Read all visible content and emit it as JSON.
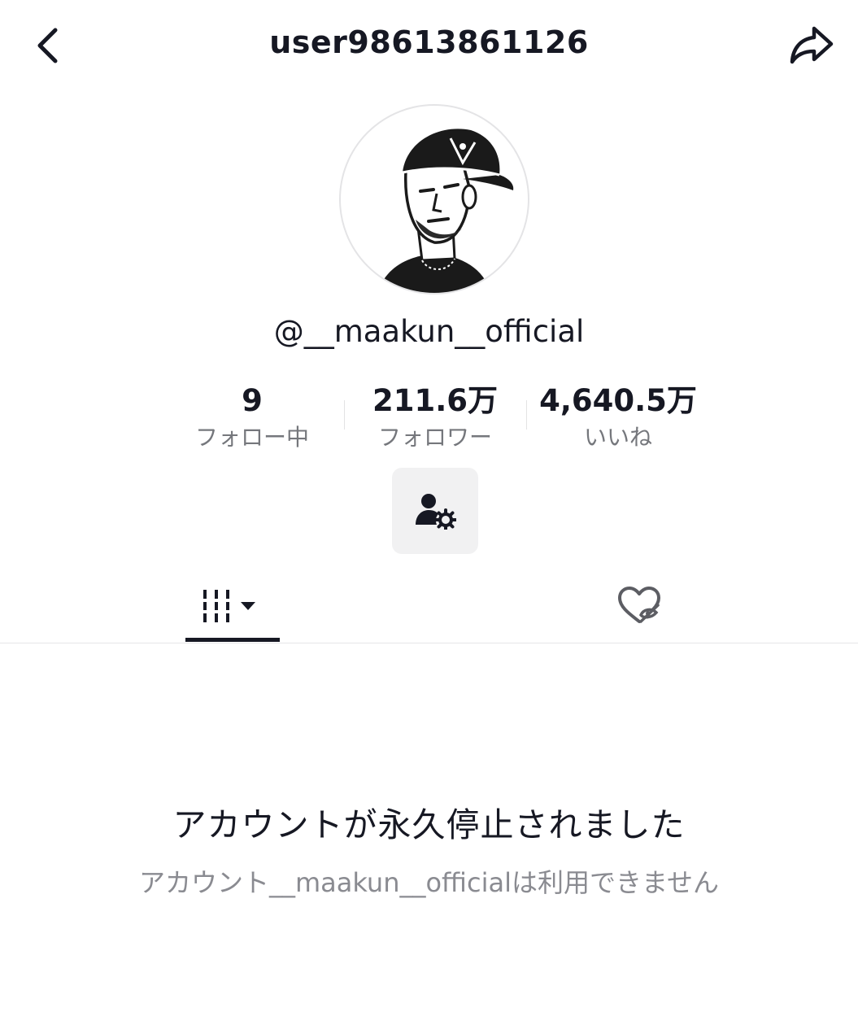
{
  "header": {
    "title": "user98613861126",
    "back_icon": "chevron-left-icon",
    "share_icon": "share-arrow-icon"
  },
  "profile": {
    "avatar": "illustrated-portrait-avatar",
    "handle": "@__maakun__official"
  },
  "stats": [
    {
      "value": "9",
      "label": "フォロー中"
    },
    {
      "value": "211.6万",
      "label": "フォロワー"
    },
    {
      "value": "4,640.5万",
      "label": "いいね"
    }
  ],
  "actions": {
    "friend_settings_icon": "person-gear-icon"
  },
  "tabs": [
    {
      "icon": "grid-bars-dropdown-icon",
      "active": true
    },
    {
      "icon": "hidden-heart-icon",
      "active": false
    }
  ],
  "banned_notice": {
    "title": "アカウントが永久停止されました",
    "subtitle": "アカウント__maakun__officialは利用できません"
  },
  "colors": {
    "text_primary": "#161823",
    "text_secondary": "#75777c",
    "button_bg": "#f1f1f2"
  }
}
